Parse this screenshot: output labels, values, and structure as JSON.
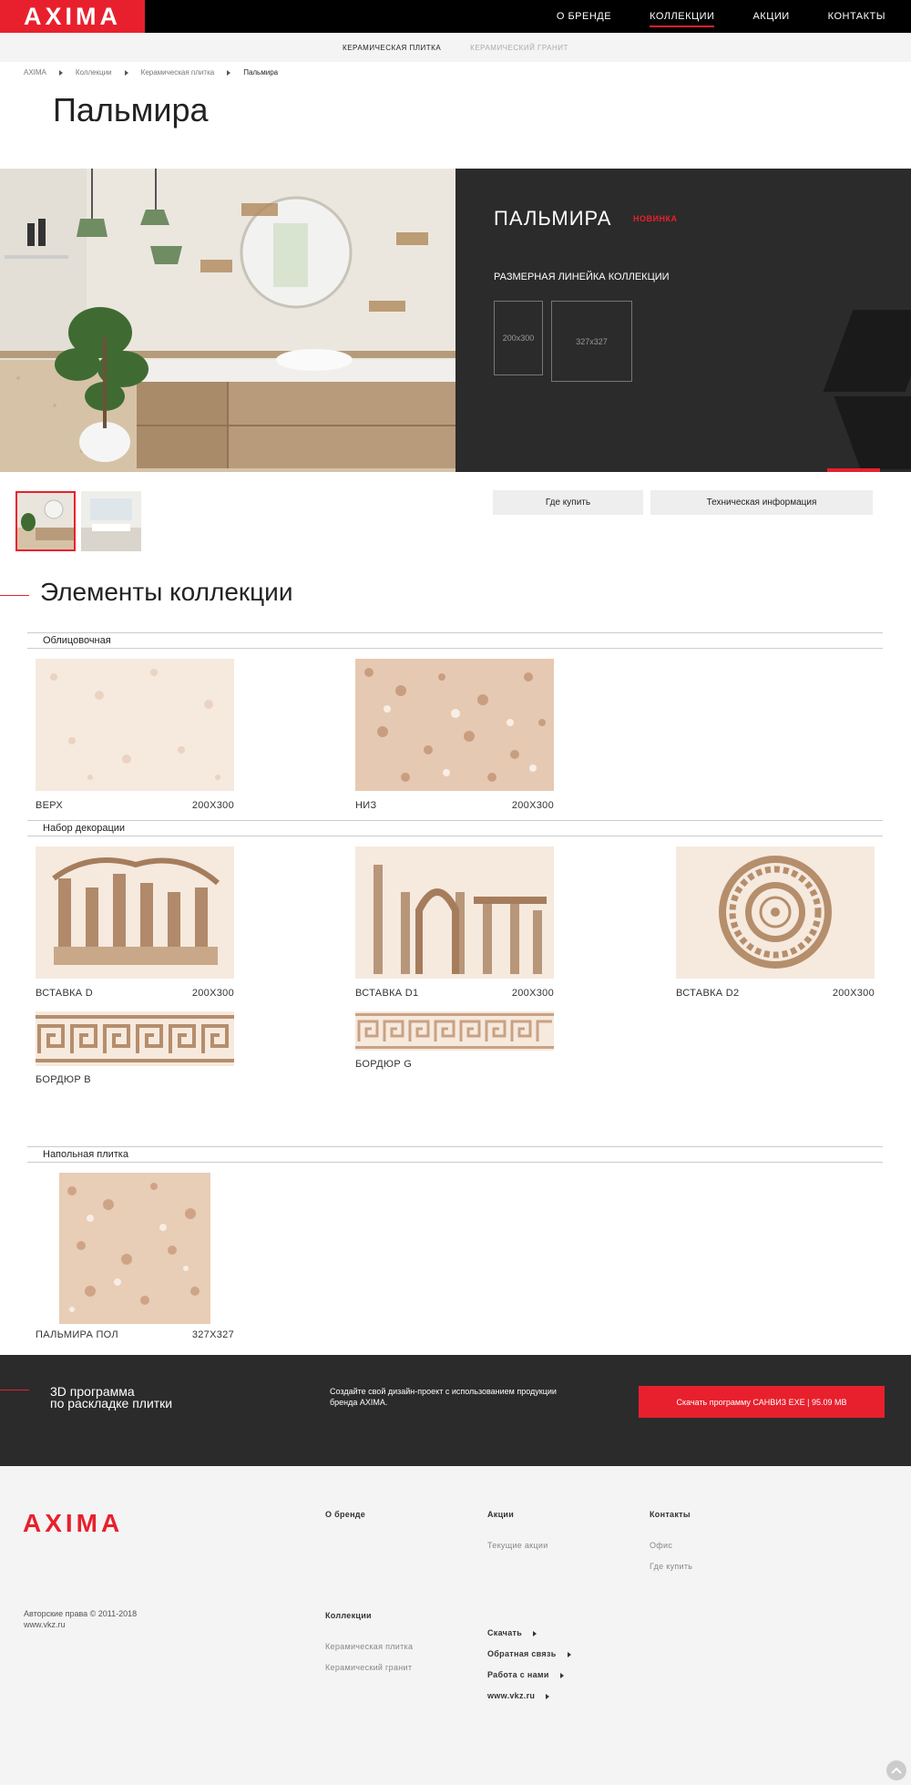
{
  "header": {
    "logo": "AXIMA",
    "nav": [
      "О БРЕНДЕ",
      "КОЛЛЕКЦИИ",
      "АКЦИИ",
      "КОНТАКТЫ"
    ]
  },
  "subnav": [
    "КЕРАМИЧЕСКАЯ ПЛИТКА",
    "КЕРАМИЧЕСКИЙ ГРАНИТ"
  ],
  "breadcrumb": [
    "AXIMA",
    "Коллекции",
    "Керамическая плитка",
    "Пальмира"
  ],
  "page_title": "Пальмира",
  "hero": {
    "name": "ПАЛЬМИРА",
    "badge": "НОВИНКА",
    "sizes_title": "РАЗМЕРНАЯ ЛИНЕЙКА КОЛЛЕКЦИИ",
    "sizes": [
      "200x300",
      "327x327"
    ]
  },
  "buttons": {
    "where_to_buy": "Где купить",
    "tech_info": "Техническая информация"
  },
  "section_title": "Элементы коллекции",
  "groups": {
    "facing": "Облицовочная",
    "decor": "Набор декорации",
    "floor": "Напольная плитка"
  },
  "tiles": {
    "top": {
      "name": "ВЕРХ",
      "size": "200X300"
    },
    "bottom": {
      "name": "НИЗ",
      "size": "200X300"
    },
    "insert_d": {
      "name": "ВСТАВКА D",
      "size": "200X300"
    },
    "insert_d1": {
      "name": "ВСТАВКА D1",
      "size": "200X300"
    },
    "insert_d2": {
      "name": "ВСТАВКА D2",
      "size": "200X300"
    },
    "border_b": {
      "name": "БОРДЮР B"
    },
    "border_g": {
      "name": "БОРДЮР G"
    },
    "floor": {
      "name": "ПАЛЬМИРА ПОЛ",
      "size": "327X327"
    }
  },
  "promo": {
    "title_line1": "3D программа",
    "title_line2": "по раскладке плитки",
    "text": "Создайте свой дизайн-проект с использованием продукции бренда AXIMA.",
    "button": "Скачать программу САНВИЗ EXE | 95.09 MB"
  },
  "footer": {
    "logo": "AXIMA",
    "copyright": "Авторские права © 2011-2018",
    "site": "www.vkz.ru",
    "col_brand": "О бренде",
    "col_collections": "Коллекции",
    "collections_links": [
      "Керамическая плитка",
      "Керамический гранит"
    ],
    "col_promo": "Акции",
    "promo_links": [
      "Текущие акции"
    ],
    "col_contacts": "Контакты",
    "contacts_links": [
      "Офис",
      "Где купить"
    ],
    "extra_links": [
      "Скачать",
      "Обратная связь",
      "Работа с нами",
      "www.vkz.ru"
    ]
  },
  "colors": {
    "accent": "#e8202d",
    "dark": "#2b2b2b",
    "light_bg": "#f4f4f4"
  }
}
